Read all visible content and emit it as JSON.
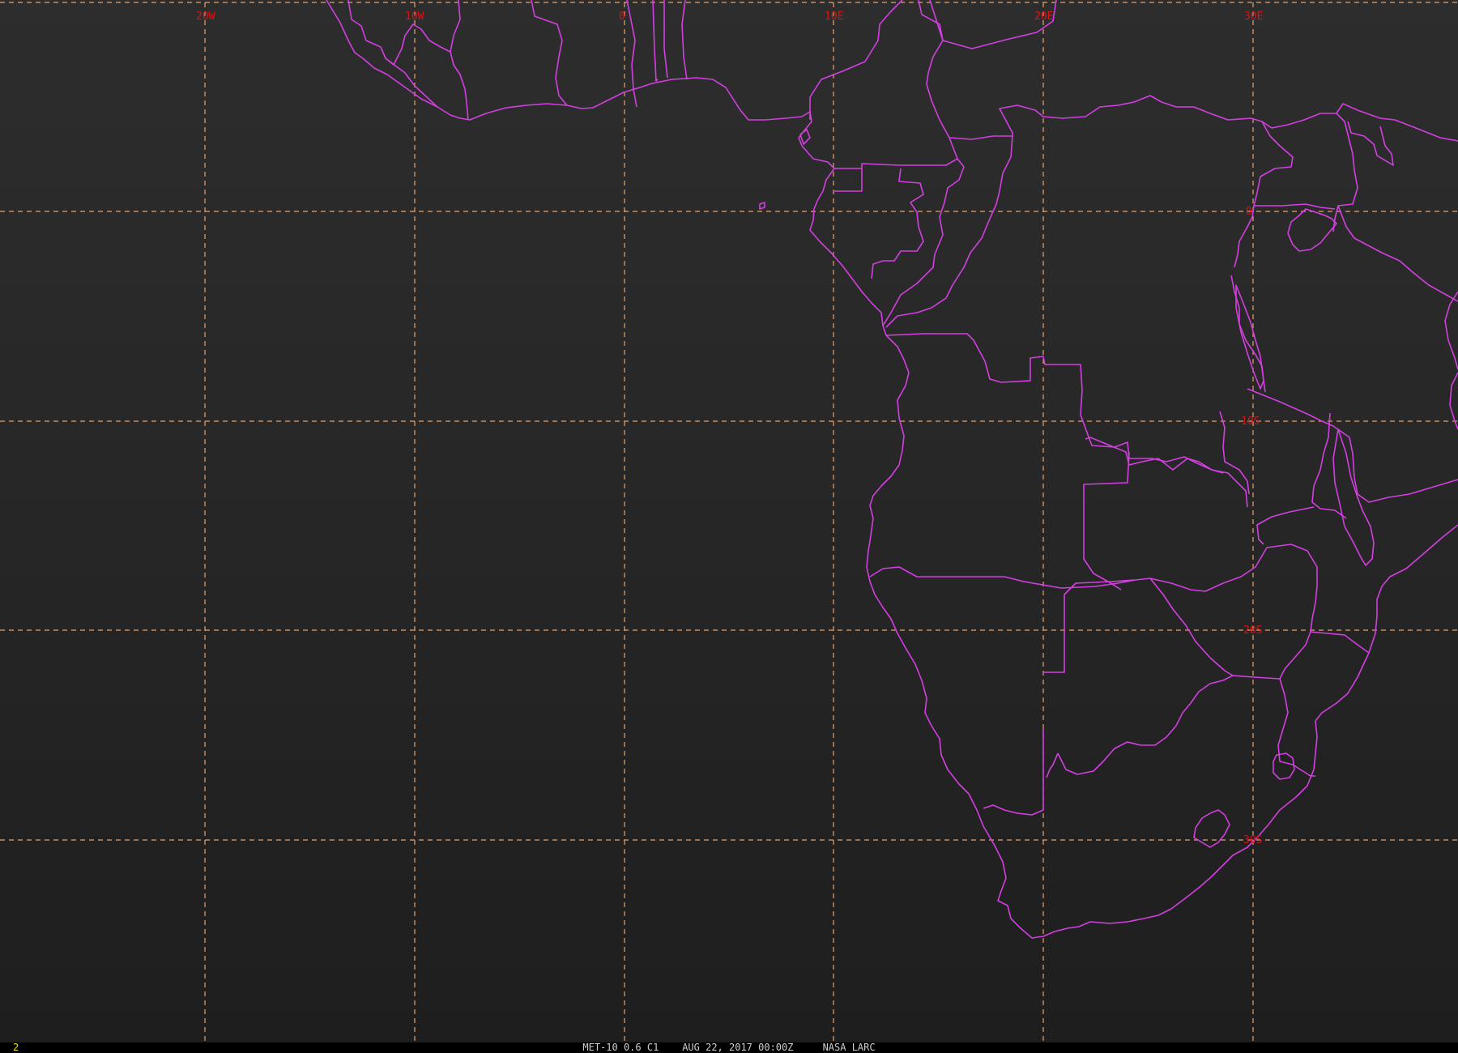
{
  "map": {
    "background_color": "#262626",
    "grid_color": "#e8a26a",
    "boundary_color": "#d33fe0",
    "label_color": "#d21818",
    "longitude_labels": [
      "20W",
      "10W",
      "0",
      "10E",
      "20E",
      "30E"
    ],
    "latitude_labels": [
      "0",
      "10S",
      "20S",
      "30S"
    ]
  },
  "status": {
    "frame_number": "2",
    "caption": "MET-10 0.6 C1    AUG 22, 2017 00:00Z     NASA LARC"
  }
}
